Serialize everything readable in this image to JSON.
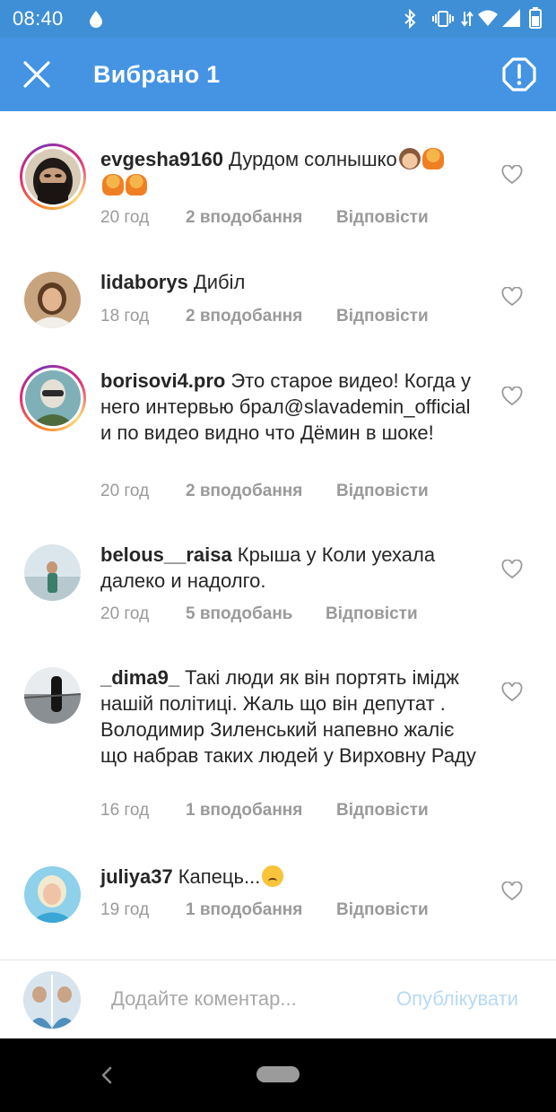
{
  "status_bar": {
    "time": "08:40",
    "icons": [
      "water-drop-icon",
      "bluetooth-icon",
      "vibrate-icon",
      "data-transfer-icon",
      "wifi-icon",
      "cell-signal-icon",
      "battery-icon"
    ]
  },
  "app_bar": {
    "title": "Вибрано 1",
    "close_icon": "close-icon",
    "report_icon": "report-icon"
  },
  "comments": [
    {
      "username": "evgesha9160",
      "text": "Дурдом солнышко",
      "emoji": [
        "see-no-evil-monkey-emoji",
        "facepalm-person-emoji",
        "facepalm-person-emoji",
        "facepalm-person-emoji"
      ],
      "time": "20 год",
      "likes": "2 вподобання",
      "reply": "Відповісти",
      "has_story_ring": true
    },
    {
      "username": "lidaborys",
      "text": "Дибіл",
      "emoji": [],
      "time": "18 год",
      "likes": "2 вподобання",
      "reply": "Відповісти",
      "has_story_ring": false
    },
    {
      "username": "borisovi4.pro",
      "text": "Это старое видео! Когда у него интервью брал@slavademin_official и по видео видно что Дёмин в шоке!",
      "emoji": [],
      "time": "20 год",
      "likes": "2 вподобання",
      "reply": "Відповісти",
      "has_story_ring": true
    },
    {
      "username": "belous__raisa",
      "text": "Крыша у Коли уехала далеко и надолго.",
      "emoji": [],
      "time": "20 год",
      "likes": "5 вподобань",
      "reply": "Відповісти",
      "has_story_ring": false
    },
    {
      "username": "_dima9_",
      "text": "Такі люди як він портять імідж нашій політиці. Жаль що він депутат . Володимир Зиленський напевно жаліє що набрав таких людей у Вирховну Раду",
      "emoji": [],
      "time": "16 год",
      "likes": "1 вподобання",
      "reply": "Відповісти",
      "has_story_ring": false
    },
    {
      "username": "juliya37",
      "text": "Капець...",
      "emoji": [
        "sad-face-emoji"
      ],
      "time": "19 год",
      "likes": "1 вподобання",
      "reply": "Відповісти",
      "has_story_ring": false
    }
  ],
  "composer": {
    "placeholder": "Додайте коментар...",
    "value": "",
    "publish_label": "Опублікувати",
    "publish_color": "#b9d9f4"
  },
  "colors": {
    "status_bar": "#3f8fd6",
    "app_bar": "#4494e3",
    "meta_text": "#9a9a9a"
  }
}
